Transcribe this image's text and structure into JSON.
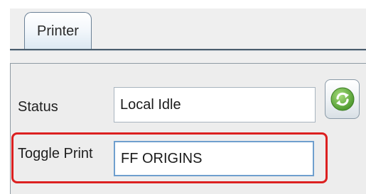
{
  "tabs": [
    {
      "label": "Printer",
      "selected": true
    }
  ],
  "form": {
    "status_label": "Status",
    "status_value": "Local Idle",
    "toggle_label": "Toggle Print",
    "toggle_value": "FF ORIGINS"
  },
  "refresh_button": {
    "icon": "refresh-icon"
  },
  "highlight": {
    "color": "#dc2020",
    "target": "toggle-print-row"
  },
  "colors": {
    "refresh_icon_green": "#5cab3c",
    "focus_border": "#6f9fce"
  }
}
